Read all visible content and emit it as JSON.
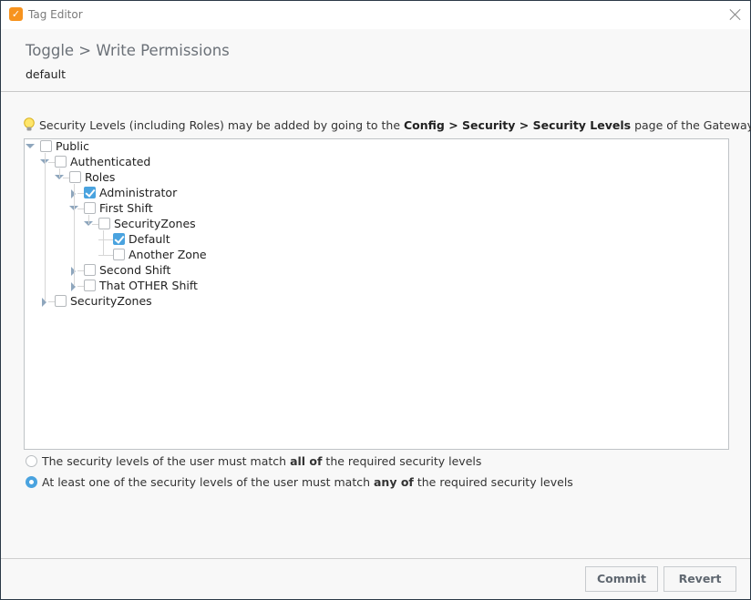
{
  "window": {
    "title": "Tag Editor",
    "app_icon": "ignition-tag-icon",
    "close_icon": "close-icon"
  },
  "header": {
    "breadcrumb": "Toggle > Write Permissions",
    "subtitle": "default"
  },
  "hint": {
    "icon": "lightbulb-icon",
    "prefix": "Security Levels (including Roles) may be added by going to the ",
    "bold": "Config > Security > Security Levels",
    "suffix": " page of the Gateway Web Interface"
  },
  "tree": {
    "nodes": [
      {
        "label": "Public",
        "level": 0,
        "toggle": "expanded",
        "checked": false
      },
      {
        "label": "Authenticated",
        "level": 1,
        "toggle": "expanded",
        "checked": false
      },
      {
        "label": "Roles",
        "level": 2,
        "toggle": "expanded",
        "checked": false
      },
      {
        "label": "Administrator",
        "level": 3,
        "toggle": "collapsed",
        "checked": true
      },
      {
        "label": "First Shift",
        "level": 3,
        "toggle": "expanded",
        "checked": false
      },
      {
        "label": "SecurityZones",
        "level": 4,
        "toggle": "expanded",
        "checked": false
      },
      {
        "label": "Default",
        "level": 5,
        "toggle": "none",
        "checked": true
      },
      {
        "label": "Another Zone",
        "level": 5,
        "toggle": "none",
        "checked": false
      },
      {
        "label": "Second Shift",
        "level": 3,
        "toggle": "collapsed",
        "checked": false
      },
      {
        "label": "That OTHER Shift",
        "level": 3,
        "toggle": "collapsed",
        "checked": false
      },
      {
        "label": "SecurityZones",
        "level": 1,
        "toggle": "collapsed",
        "checked": false
      }
    ]
  },
  "match_options": [
    {
      "prefix": "The security levels of the user must match ",
      "bold": "all of",
      "suffix": " the required security levels",
      "selected": false
    },
    {
      "prefix": "At least one of the security levels of the user must match ",
      "bold": "any of",
      "suffix": " the required security levels",
      "selected": true
    }
  ],
  "footer": {
    "commit_label": "Commit",
    "revert_label": "Revert"
  },
  "colors": {
    "accent": "#4aa3df",
    "app_icon": "#f7931e",
    "tree_toggle": "#8ea6bd"
  }
}
